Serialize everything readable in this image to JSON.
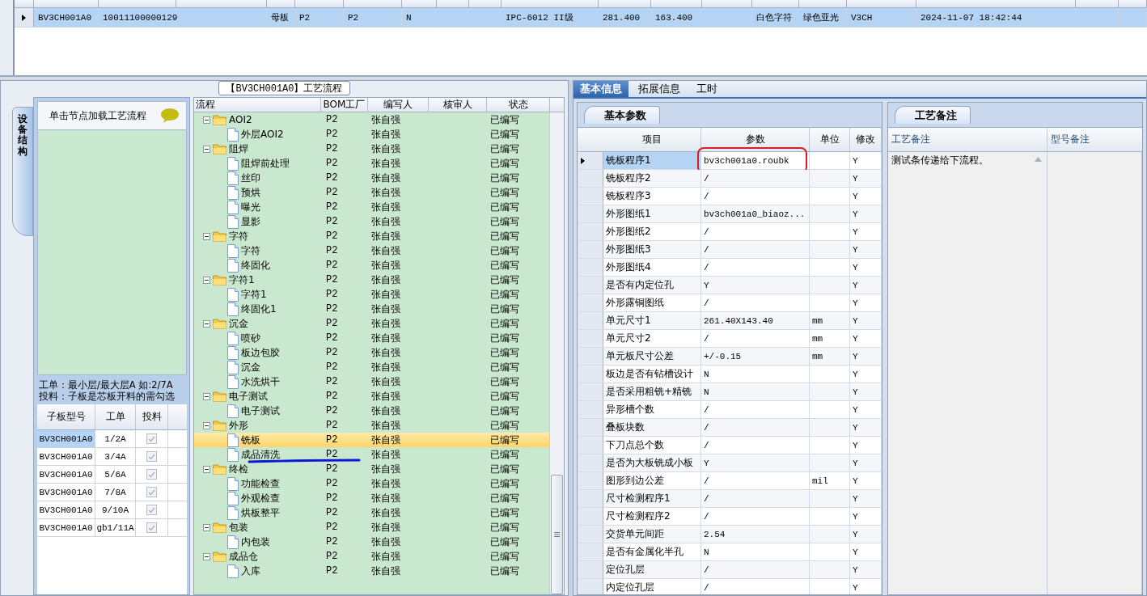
{
  "top_grid": {
    "rows": [
      {
        "selected": true,
        "cells": [
          {
            "text": "BV3CH001A0"
          },
          {
            "text": "10011100000129"
          },
          {},
          {
            "text": "母板"
          },
          {
            "text": "P2"
          },
          {
            "text": "P2"
          },
          {
            "text": "N"
          },
          {},
          {},
          {
            "text": "IPC-6012 II级"
          },
          {
            "text": "281.400"
          },
          {
            "text": "163.400"
          },
          {},
          {
            "text": "白色字符"
          },
          {
            "text": "绿色亚光"
          },
          {
            "text": "V3CH"
          },
          {
            "text": "2024-11-07 18:42:44"
          },
          {},
          {}
        ]
      }
    ]
  },
  "process_group": {
    "title": "【BV3CH001A0】工艺流程",
    "side_tab": "设备结构",
    "hint": "单击节点加载工艺流程",
    "note_lines": [
      "工单：最小层/最大层A 如:2/7A",
      "投料：子板是芯板开料的需勾选"
    ],
    "sub_grid": {
      "columns": [
        "子板型号",
        "工单",
        "投料"
      ],
      "rows": [
        {
          "model": "BV3CH001A0",
          "order": "1/2A",
          "checked": true,
          "selected": true
        },
        {
          "model": "BV3CH001A0",
          "order": "3/4A",
          "checked": true,
          "selected": false
        },
        {
          "model": "BV3CH001A0",
          "order": "5/6A",
          "checked": true,
          "selected": false
        },
        {
          "model": "BV3CH001A0",
          "order": "7/8A",
          "checked": true,
          "selected": false
        },
        {
          "model": "BV3CH001A0",
          "order": "9/10A",
          "checked": true,
          "selected": false
        },
        {
          "model": "BV3CH001A0",
          "order": "gb1/11A",
          "checked": true,
          "selected": false
        }
      ]
    },
    "tree": {
      "columns": [
        "流程",
        "BOM工厂",
        "编写人",
        "核审人",
        "状态"
      ],
      "nodes": [
        {
          "name": "AOI2",
          "bom": "P2",
          "writer": "张自强",
          "status": "已编写",
          "expanded": true,
          "selected": false,
          "children": [
            {
              "name": "外层AOI2",
              "bom": "P2",
              "writer": "张自强",
              "status": "已编写",
              "selected": false
            }
          ]
        },
        {
          "name": "阻焊",
          "bom": "P2",
          "writer": "张自强",
          "status": "已编写",
          "expanded": true,
          "selected": false,
          "children": [
            {
              "name": "阻焊前处理",
              "bom": "P2",
              "writer": "张自强",
              "status": "已编写",
              "selected": false
            },
            {
              "name": "丝印",
              "bom": "P2",
              "writer": "张自强",
              "status": "已编写",
              "selected": false
            },
            {
              "name": "预烘",
              "bom": "P2",
              "writer": "张自强",
              "status": "已编写",
              "selected": false
            },
            {
              "name": "曝光",
              "bom": "P2",
              "writer": "张自强",
              "status": "已编写",
              "selected": false
            },
            {
              "name": "显影",
              "bom": "P2",
              "writer": "张自强",
              "status": "已编写",
              "selected": false
            }
          ]
        },
        {
          "name": "字符",
          "bom": "P2",
          "writer": "张自强",
          "status": "已编写",
          "expanded": true,
          "selected": false,
          "children": [
            {
              "name": "字符",
              "bom": "P2",
              "writer": "张自强",
              "status": "已编写",
              "selected": false
            },
            {
              "name": "终固化",
              "bom": "P2",
              "writer": "张自强",
              "status": "已编写",
              "selected": false
            }
          ]
        },
        {
          "name": "字符1",
          "bom": "P2",
          "writer": "张自强",
          "status": "已编写",
          "expanded": true,
          "selected": false,
          "children": [
            {
              "name": "字符1",
              "bom": "P2",
              "writer": "张自强",
              "status": "已编写",
              "selected": false
            },
            {
              "name": "终固化1",
              "bom": "P2",
              "writer": "张自强",
              "status": "已编写",
              "selected": false
            }
          ]
        },
        {
          "name": "沉金",
          "bom": "P2",
          "writer": "张自强",
          "status": "已编写",
          "expanded": true,
          "selected": false,
          "children": [
            {
              "name": "喷砂",
              "bom": "P2",
              "writer": "张自强",
              "status": "已编写",
              "selected": false
            },
            {
              "name": "板边包胶",
              "bom": "P2",
              "writer": "张自强",
              "status": "已编写",
              "selected": false
            },
            {
              "name": "沉金",
              "bom": "P2",
              "writer": "张自强",
              "status": "已编写",
              "selected": false
            },
            {
              "name": "水洗烘干",
              "bom": "P2",
              "writer": "张自强",
              "status": "已编写",
              "selected": false
            }
          ]
        },
        {
          "name": "电子测试",
          "bom": "P2",
          "writer": "张自强",
          "status": "已编写",
          "expanded": true,
          "selected": false,
          "children": [
            {
              "name": "电子测试",
              "bom": "P2",
              "writer": "张自强",
              "status": "已编写",
              "selected": false
            }
          ]
        },
        {
          "name": "外形",
          "bom": "P2",
          "writer": "张自强",
          "status": "已编写",
          "expanded": true,
          "selected": false,
          "children": [
            {
              "name": "铣板",
              "bom": "P2",
              "writer": "张自强",
              "status": "已编写",
              "selected": true
            },
            {
              "name": "成品清洗",
              "bom": "P2",
              "writer": "张自强",
              "status": "已编写",
              "selected": false,
              "scribbled": true
            }
          ]
        },
        {
          "name": "终检",
          "bom": "P2",
          "writer": "张自强",
          "status": "已编写",
          "expanded": true,
          "selected": false,
          "children": [
            {
              "name": "功能检查",
              "bom": "P2",
              "writer": "张自强",
              "status": "已编写",
              "selected": false
            },
            {
              "name": "外观检查",
              "bom": "P2",
              "writer": "张自强",
              "status": "已编写",
              "selected": false
            },
            {
              "name": "烘板整平",
              "bom": "P2",
              "writer": "张自强",
              "status": "已编写",
              "selected": false
            }
          ]
        },
        {
          "name": "包装",
          "bom": "P2",
          "writer": "张自强",
          "status": "已编写",
          "expanded": true,
          "selected": false,
          "children": [
            {
              "name": "内包装",
              "bom": "P2",
              "writer": "张自强",
              "status": "已编写",
              "selected": false
            }
          ]
        },
        {
          "name": "成品仓",
          "bom": "P2",
          "writer": "张自强",
          "status": "已编写",
          "expanded": true,
          "selected": false,
          "children": [
            {
              "name": "入库",
              "bom": "P2",
              "writer": "张自强",
              "status": "已编写",
              "selected": false
            }
          ]
        }
      ]
    }
  },
  "info_tabs": [
    {
      "label": "基本信息",
      "selected": true
    },
    {
      "label": "拓展信息",
      "selected": false
    },
    {
      "label": "工时",
      "selected": false
    }
  ],
  "params_panel": {
    "tab": "基本参数",
    "columns": [
      "项目",
      "参数",
      "单位",
      "修改"
    ],
    "rows": [
      {
        "item": "铣板程序1",
        "value": "bv3ch001a0.roubk",
        "modified": "Y",
        "selected": true,
        "circled": true
      },
      {
        "item": "铣板程序2",
        "value": "/",
        "modified": "Y",
        "selected": false
      },
      {
        "item": "铣板程序3",
        "value": "/",
        "modified": "Y",
        "selected": false
      },
      {
        "item": "外形图纸1",
        "value": "bv3ch001a0_biaoz...",
        "modified": "Y",
        "selected": false
      },
      {
        "item": "外形图纸2",
        "value": "/",
        "modified": "Y",
        "selected": false
      },
      {
        "item": "外形图纸3",
        "value": "/",
        "modified": "Y",
        "selected": false
      },
      {
        "item": "外形图纸4",
        "value": "/",
        "modified": "Y",
        "selected": false
      },
      {
        "item": "是否有内定位孔",
        "value": "Y",
        "modified": "Y",
        "selected": false
      },
      {
        "item": "外形露铜图纸",
        "value": "/",
        "modified": "Y",
        "selected": false
      },
      {
        "item": "单元尺寸1",
        "value": "261.40X143.40",
        "unit": "mm",
        "modified": "Y",
        "selected": false
      },
      {
        "item": "单元尺寸2",
        "value": "/",
        "unit": "mm",
        "modified": "Y",
        "selected": false
      },
      {
        "item": "单元板尺寸公差",
        "value": "+/-0.15",
        "unit": "mm",
        "modified": "Y",
        "selected": false
      },
      {
        "item": "板边是否有钻槽设计",
        "value": "N",
        "modified": "Y",
        "selected": false
      },
      {
        "item": "是否采用粗铣+精铣",
        "value": "N",
        "modified": "Y",
        "selected": false
      },
      {
        "item": "异形槽个数",
        "value": "/",
        "modified": "Y",
        "selected": false
      },
      {
        "item": "叠板块数",
        "value": "/",
        "modified": "Y",
        "selected": false
      },
      {
        "item": "下刀点总个数",
        "value": "/",
        "modified": "Y",
        "selected": false
      },
      {
        "item": "是否为大板铣成小板",
        "value": "Y",
        "modified": "Y",
        "selected": false
      },
      {
        "item": "图形到边公差",
        "value": "/",
        "unit": "mil",
        "modified": "Y",
        "selected": false
      },
      {
        "item": "尺寸检测程序1",
        "value": "/",
        "modified": "Y",
        "selected": false
      },
      {
        "item": "尺寸检测程序2",
        "value": "/",
        "modified": "Y",
        "selected": false
      },
      {
        "item": "交货单元间距",
        "value": "2.54",
        "modified": "Y",
        "selected": false
      },
      {
        "item": "是否有金属化半孔",
        "value": "N",
        "modified": "Y",
        "selected": false
      },
      {
        "item": "定位孔层",
        "value": "/",
        "modified": "Y",
        "selected": false
      },
      {
        "item": "内定位孔层",
        "value": "/",
        "modified": "Y",
        "selected": false
      }
    ]
  },
  "notes_panel": {
    "tab": "工艺备注",
    "columns": [
      "工艺备注",
      "型号备注"
    ],
    "process_note": "测试条传递给下流程。"
  }
}
